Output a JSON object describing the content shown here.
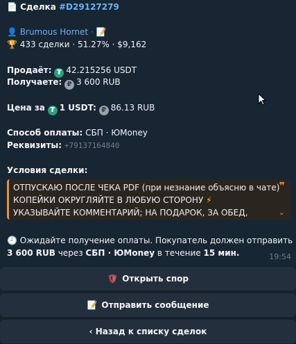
{
  "deal": {
    "icon": "document-icon",
    "label": "Сделка",
    "id": "#D29127279"
  },
  "seller": {
    "name": "Brumous Hornet",
    "separator": "·",
    "deals": "433 сделки",
    "rate": "51.27%",
    "volume": "$9,162"
  },
  "sell": {
    "label": "Продаёт:",
    "amount": "42.215256 USDT"
  },
  "receive": {
    "label": "Получаете:",
    "amount": "3 600 RUB"
  },
  "price": {
    "label": "Цена за",
    "unit": "1 USDT:",
    "value": "86.13 RUB"
  },
  "payment": {
    "label": "Способ оплаты:",
    "value": "СБП · ЮMoney"
  },
  "details": {
    "label": "Реквизиты:",
    "value": "+79137164840"
  },
  "conditions": {
    "label": "Условия сделки:",
    "lines": [
      "ОТПУСКАЮ ПОСЛЕ ЧЕКА PDF (при незнание объясню в чате)",
      "КОПЕЙКИ ОКРУГЛЯЙТЕ В ЛЮБУЮ СТОРОНУ",
      "УКАЗЫВАЙТЕ КОММЕНТАРИЙ; НА ПОДАРОК, ЗА ОБЕД,"
    ]
  },
  "status": {
    "line1": "Ожидайте получение оплаты. Покупатель должен отправить",
    "amount": "3 600 RUB",
    "via": "через",
    "method": "СБП · ЮMoney",
    "within": "в течение",
    "time": "15 мин."
  },
  "message_time": "19:54",
  "buttons": {
    "dispute": "Открыть спор",
    "message": "Отправить сообщение",
    "back": "‹ Назад к списку сделок"
  },
  "colors": {
    "background": "#17212b",
    "link": "#6ab3f3",
    "usdt": "#26a17b",
    "quote_accent": "#e8923a"
  }
}
